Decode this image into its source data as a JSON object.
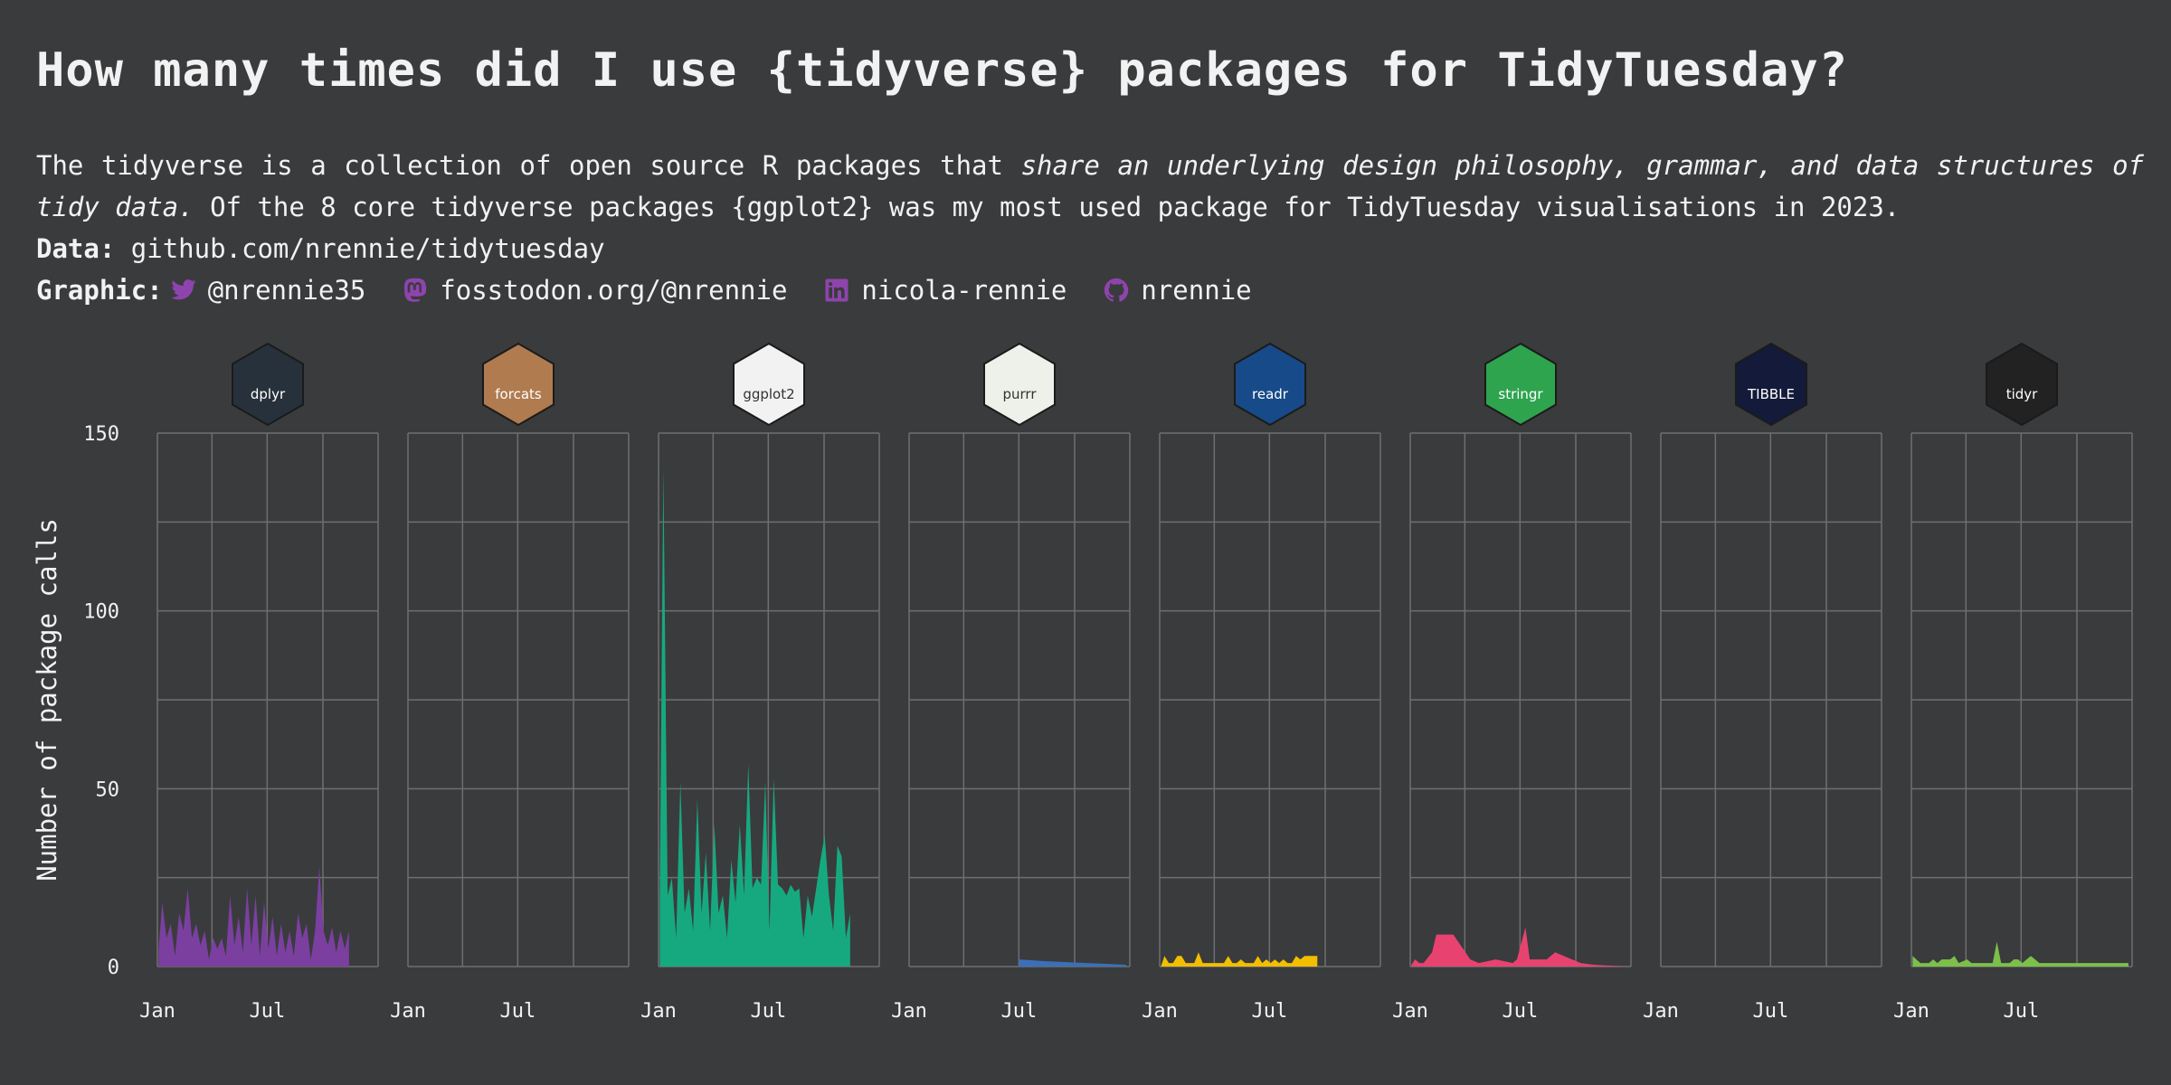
{
  "header": {
    "title": "How many times did I use {tidyverse} packages for TidyTuesday?",
    "subtitle_line1_plain": "The tidyverse is a collection of open source R packages that",
    "subtitle_line1_italic": "share an underlying design philosophy, grammar, and data structures of",
    "subtitle_line2_italic": "tidy data.",
    "subtitle_line2_plain": "Of the 8 core tidyverse packages {ggplot2} was my most used package for TidyTuesday visualisations in 2023.",
    "data_label": "Data:",
    "data_value": "github.com/nrennie/tidytuesday",
    "graphic_label": "Graphic:",
    "social": [
      {
        "icon": "twitter-icon",
        "text": "@nrennie35"
      },
      {
        "icon": "mastodon-icon",
        "text": "fosstodon.org/@nrennie"
      },
      {
        "icon": "linkedin-icon",
        "text": "nicola-rennie"
      },
      {
        "icon": "github-icon",
        "text": "nrennie"
      }
    ],
    "social_icon_color": "#8e44ad"
  },
  "chart_data": {
    "type": "area",
    "ylabel": "Number of package calls",
    "ylim": [
      0,
      150
    ],
    "y_ticks": [
      0,
      50,
      100,
      150
    ],
    "x_range": [
      "2023-01-01",
      "2023-12-31"
    ],
    "x_ticks": [
      "Jan",
      "Jul"
    ],
    "grid": true,
    "facets": [
      {
        "package": "dplyr",
        "logo_text": "dplyr",
        "logo_bg": "#27313b",
        "color": "#7b3fa0",
        "points": [
          [
            "2023-01-03",
            5
          ],
          [
            "2023-01-09",
            18
          ],
          [
            "2023-01-16",
            8
          ],
          [
            "2023-01-23",
            12
          ],
          [
            "2023-01-30",
            3
          ],
          [
            "2023-02-06",
            15
          ],
          [
            "2023-02-13",
            10
          ],
          [
            "2023-02-20",
            22
          ],
          [
            "2023-02-27",
            8
          ],
          [
            "2023-03-06",
            12
          ],
          [
            "2023-03-13",
            6
          ],
          [
            "2023-03-20",
            10
          ],
          [
            "2023-03-27",
            2
          ],
          [
            "2023-04-03",
            8
          ],
          [
            "2023-04-10",
            5
          ],
          [
            "2023-04-17",
            8
          ],
          [
            "2023-04-24",
            3
          ],
          [
            "2023-05-01",
            20
          ],
          [
            "2023-05-08",
            6
          ],
          [
            "2023-05-15",
            14
          ],
          [
            "2023-05-22",
            4
          ],
          [
            "2023-05-29",
            22
          ],
          [
            "2023-06-05",
            6
          ],
          [
            "2023-06-12",
            20
          ],
          [
            "2023-06-19",
            3
          ],
          [
            "2023-06-26",
            18
          ],
          [
            "2023-07-03",
            5
          ],
          [
            "2023-07-10",
            14
          ],
          [
            "2023-07-17",
            3
          ],
          [
            "2023-07-24",
            12
          ],
          [
            "2023-07-31",
            4
          ],
          [
            "2023-08-07",
            10
          ],
          [
            "2023-08-14",
            3
          ],
          [
            "2023-08-21",
            15
          ],
          [
            "2023-08-28",
            8
          ],
          [
            "2023-09-04",
            12
          ],
          [
            "2023-09-11",
            2
          ],
          [
            "2023-09-18",
            10
          ],
          [
            "2023-09-25",
            28
          ],
          [
            "2023-10-02",
            10
          ],
          [
            "2023-10-09",
            6
          ],
          [
            "2023-10-16",
            11
          ],
          [
            "2023-10-23",
            4
          ],
          [
            "2023-10-30",
            10
          ],
          [
            "2023-11-06",
            5
          ],
          [
            "2023-11-13",
            10
          ]
        ]
      },
      {
        "package": "forcats",
        "logo_text": "forcats",
        "logo_bg": "#b07b4f",
        "color": "#d07c3a",
        "points": []
      },
      {
        "package": "ggplot2",
        "logo_text": "ggplot2",
        "logo_bg": "#f2f2f2",
        "color": "#16a97f",
        "points": [
          [
            "2023-01-03",
            20
          ],
          [
            "2023-01-09",
            140
          ],
          [
            "2023-01-16",
            20
          ],
          [
            "2023-01-23",
            25
          ],
          [
            "2023-01-30",
            8
          ],
          [
            "2023-02-06",
            52
          ],
          [
            "2023-02-13",
            15
          ],
          [
            "2023-02-20",
            22
          ],
          [
            "2023-02-27",
            10
          ],
          [
            "2023-03-06",
            47
          ],
          [
            "2023-03-13",
            15
          ],
          [
            "2023-03-20",
            32
          ],
          [
            "2023-03-27",
            10
          ],
          [
            "2023-04-03",
            40
          ],
          [
            "2023-04-10",
            15
          ],
          [
            "2023-04-17",
            20
          ],
          [
            "2023-04-24",
            8
          ],
          [
            "2023-05-01",
            30
          ],
          [
            "2023-05-08",
            18
          ],
          [
            "2023-05-15",
            40
          ],
          [
            "2023-05-22",
            20
          ],
          [
            "2023-05-29",
            57
          ],
          [
            "2023-06-05",
            22
          ],
          [
            "2023-06-12",
            25
          ],
          [
            "2023-06-19",
            23
          ],
          [
            "2023-06-26",
            52
          ],
          [
            "2023-07-03",
            10
          ],
          [
            "2023-07-10",
            53
          ],
          [
            "2023-07-17",
            23
          ],
          [
            "2023-07-24",
            22
          ],
          [
            "2023-07-31",
            20
          ],
          [
            "2023-08-07",
            23
          ],
          [
            "2023-08-14",
            21
          ],
          [
            "2023-08-21",
            22
          ],
          [
            "2023-08-28",
            8
          ],
          [
            "2023-09-04",
            20
          ],
          [
            "2023-09-11",
            14
          ],
          [
            "2023-09-18",
            22
          ],
          [
            "2023-09-25",
            30
          ],
          [
            "2023-10-02",
            37
          ],
          [
            "2023-10-09",
            20
          ],
          [
            "2023-10-16",
            10
          ],
          [
            "2023-10-23",
            34
          ],
          [
            "2023-10-30",
            31
          ],
          [
            "2023-11-06",
            8
          ],
          [
            "2023-11-13",
            15
          ]
        ]
      },
      {
        "package": "purrr",
        "logo_text": "purrr",
        "logo_bg": "#eef0ea",
        "color": "#3b70b8",
        "points": [
          [
            "2023-07-01",
            2
          ],
          [
            "2023-08-15",
            1.5
          ],
          [
            "2023-12-25",
            0.5
          ]
        ]
      },
      {
        "package": "readr",
        "logo_text": "readr",
        "logo_bg": "#174a89",
        "color": "#f2be00",
        "points": [
          [
            "2023-01-03",
            0
          ],
          [
            "2023-01-09",
            3
          ],
          [
            "2023-01-16",
            1
          ],
          [
            "2023-01-23",
            1
          ],
          [
            "2023-01-30",
            3
          ],
          [
            "2023-02-06",
            3
          ],
          [
            "2023-02-13",
            1
          ],
          [
            "2023-02-20",
            1
          ],
          [
            "2023-02-27",
            1
          ],
          [
            "2023-03-06",
            4
          ],
          [
            "2023-03-13",
            1
          ],
          [
            "2023-03-20",
            1
          ],
          [
            "2023-03-27",
            1
          ],
          [
            "2023-04-03",
            1
          ],
          [
            "2023-04-10",
            1
          ],
          [
            "2023-04-17",
            1
          ],
          [
            "2023-04-24",
            3
          ],
          [
            "2023-05-01",
            1
          ],
          [
            "2023-05-08",
            1
          ],
          [
            "2023-05-15",
            2
          ],
          [
            "2023-05-22",
            1
          ],
          [
            "2023-05-29",
            1
          ],
          [
            "2023-06-05",
            1
          ],
          [
            "2023-06-12",
            3
          ],
          [
            "2023-06-19",
            1
          ],
          [
            "2023-06-26",
            2
          ],
          [
            "2023-07-03",
            1
          ],
          [
            "2023-07-10",
            2
          ],
          [
            "2023-07-17",
            1
          ],
          [
            "2023-07-24",
            2
          ],
          [
            "2023-07-31",
            1
          ],
          [
            "2023-08-07",
            1
          ],
          [
            "2023-08-14",
            3
          ],
          [
            "2023-08-21",
            2
          ],
          [
            "2023-08-28",
            3
          ],
          [
            "2023-09-04",
            3
          ],
          [
            "2023-09-11",
            3
          ],
          [
            "2023-09-18",
            3
          ]
        ]
      },
      {
        "package": "stringr",
        "logo_text": "stringr",
        "logo_bg": "#2ea44f",
        "color": "#e84370",
        "points": [
          [
            "2023-01-03",
            0.5
          ],
          [
            "2023-01-09",
            2
          ],
          [
            "2023-01-16",
            1
          ],
          [
            "2023-01-23",
            1
          ],
          [
            "2023-02-06",
            4
          ],
          [
            "2023-02-13",
            9
          ],
          [
            "2023-03-13",
            9
          ],
          [
            "2023-04-10",
            2
          ],
          [
            "2023-04-24",
            1
          ],
          [
            "2023-05-22",
            2
          ],
          [
            "2023-06-19",
            1
          ],
          [
            "2023-06-26",
            2
          ],
          [
            "2023-07-10",
            11
          ],
          [
            "2023-07-17",
            2
          ],
          [
            "2023-08-14",
            2
          ],
          [
            "2023-08-28",
            4
          ],
          [
            "2023-09-11",
            3
          ],
          [
            "2023-10-09",
            1
          ],
          [
            "2023-10-30",
            0.5
          ],
          [
            "2023-12-25",
            0
          ]
        ]
      },
      {
        "package": "tibble",
        "logo_text": "TIBBLE",
        "logo_bg": "#141a3a",
        "color": "#e6c200",
        "points": []
      },
      {
        "package": "tidyr",
        "logo_text": "tidyr",
        "logo_bg": "#222222",
        "color": "#7cc04a",
        "points": [
          [
            "2023-01-03",
            3
          ],
          [
            "2023-01-09",
            2
          ],
          [
            "2023-01-16",
            1
          ],
          [
            "2023-01-23",
            1
          ],
          [
            "2023-01-30",
            1
          ],
          [
            "2023-02-06",
            2
          ],
          [
            "2023-02-13",
            1
          ],
          [
            "2023-02-20",
            2
          ],
          [
            "2023-02-27",
            2
          ],
          [
            "2023-03-06",
            2
          ],
          [
            "2023-03-13",
            3
          ],
          [
            "2023-03-20",
            1
          ],
          [
            "2023-04-03",
            2
          ],
          [
            "2023-04-10",
            1
          ],
          [
            "2023-04-17",
            1
          ],
          [
            "2023-04-24",
            1
          ],
          [
            "2023-05-01",
            1
          ],
          [
            "2023-05-08",
            1
          ],
          [
            "2023-05-15",
            1
          ],
          [
            "2023-05-22",
            7
          ],
          [
            "2023-05-29",
            1
          ],
          [
            "2023-06-05",
            1
          ],
          [
            "2023-06-12",
            1
          ],
          [
            "2023-06-19",
            2
          ],
          [
            "2023-06-26",
            2
          ],
          [
            "2023-07-03",
            1
          ],
          [
            "2023-07-10",
            2
          ],
          [
            "2023-07-17",
            3
          ],
          [
            "2023-07-24",
            2
          ],
          [
            "2023-07-31",
            1
          ],
          [
            "2023-08-07",
            1
          ],
          [
            "2023-08-14",
            1
          ],
          [
            "2023-09-04",
            1
          ],
          [
            "2023-10-02",
            1
          ],
          [
            "2023-11-06",
            1
          ],
          [
            "2023-12-25",
            1
          ]
        ]
      }
    ]
  }
}
